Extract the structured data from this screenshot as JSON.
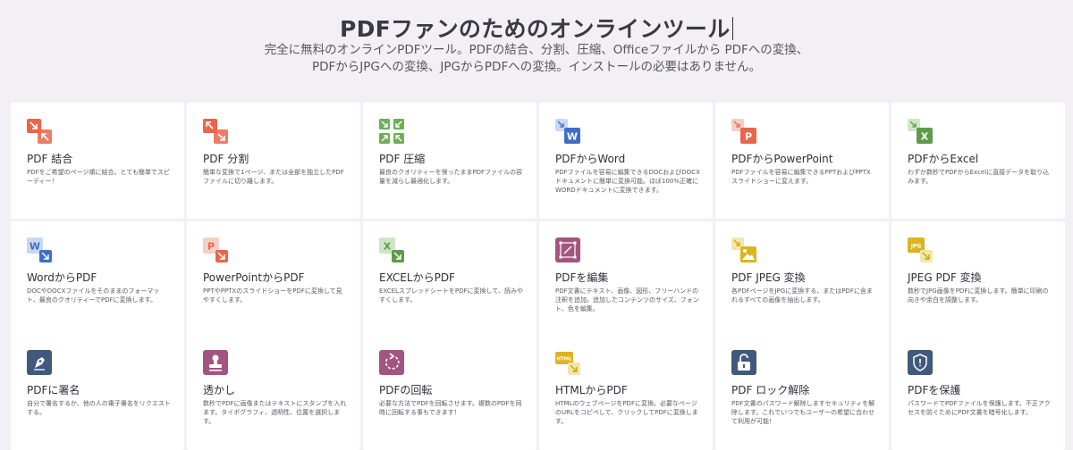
{
  "header": {
    "title": "PDFファンのためのオンラインツール",
    "subtitle_line1": "完全に無料のオンラインPDFツール。PDFの結合、分割、圧縮、Officeファイルから PDFへの変換、",
    "subtitle_line2": "PDFからJPGへの変換、JPGからPDFへの変換。インストールの必要はありません。"
  },
  "tools": [
    {
      "id": "merge",
      "icon": "merge-icon",
      "name": "PDF 結合",
      "desc": "PDFをご希望のページ順に結合。とても簡単でスピーディー！"
    },
    {
      "id": "split",
      "icon": "split-icon",
      "name": "PDF 分割",
      "desc": "簡単な変換で1ページ、または全部を独立したPDFファイルに切り離します。"
    },
    {
      "id": "compress",
      "icon": "compress-icon",
      "name": "PDF 圧縮",
      "desc": "最良のクオリティーを保ったままPDFファイルの容量を減らし最適化します。"
    },
    {
      "id": "pdf-to-word",
      "icon": "word-icon",
      "name": "PDFからWord",
      "desc": "PDFファイルを容易に編集できるDOCおよびDOCXドキュメントに簡単に変換可能。ほぼ100%正確にWORDドキュメントに変換できます。"
    },
    {
      "id": "pdf-to-powerpoint",
      "icon": "powerpoint-icon",
      "name": "PDFからPowerPoint",
      "desc": "PDFファイルを容易に編集できるPPTおよびPPTXスライドショーに変えます。"
    },
    {
      "id": "pdf-to-excel",
      "icon": "excel-icon",
      "name": "PDFからExcel",
      "desc": "わずか数秒でPDFからExcelに直接データを取り込みます。"
    },
    {
      "id": "word-to-pdf",
      "icon": "word-icon",
      "name": "WordからPDF",
      "desc": "DOCやDOCXファイルをそのままのフォーマット、最良のクオリティーでPDFに変換します。"
    },
    {
      "id": "powerpoint-to-pdf",
      "icon": "powerpoint-icon",
      "name": "PowerPointからPDF",
      "desc": "PPTやPPTXのスライドショーをPDFに変換して見やすくします。"
    },
    {
      "id": "excel-to-pdf",
      "icon": "excel-icon",
      "name": "EXCELからPDF",
      "desc": "EXCELスプレッドシートをPDFに変換して、読みやすくします。"
    },
    {
      "id": "edit-pdf",
      "icon": "edit-icon",
      "name": "PDFを編集",
      "desc": "PDF文書にテキスト、画像、図形、フリーハンドの注釈を追加。追加したコンテンツのサイズ、フォント、色を編集。"
    },
    {
      "id": "pdf-to-jpeg",
      "icon": "image-icon",
      "name": "PDF JPEG 変換",
      "desc": "各PDFページをJPGに変換する、またはPDFに含まれるすべての画像を抽出します。"
    },
    {
      "id": "jpeg-to-pdf",
      "icon": "jpg-icon",
      "name": "JPEG PDF 変換",
      "desc": "数秒でJPG画像をPDFに変換します。簡単に印刷の向きや余白を調整します。"
    },
    {
      "id": "sign-pdf",
      "icon": "pen-icon",
      "name": "PDFに署名",
      "desc": "自分で署名するか、他の人の電子署名をリクエストする。"
    },
    {
      "id": "watermark",
      "icon": "stamp-icon",
      "name": "透かし",
      "desc": "数秒でPDFに画像またはテキストにスタンプを入れます。タイポグラフィ、透明性、位置を選択します。"
    },
    {
      "id": "rotate-pdf",
      "icon": "rotate-icon",
      "name": "PDFの回転",
      "desc": "必要な方法でPDFを回転させます。複数のPDFを同時に回転する事もできます！"
    },
    {
      "id": "html-to-pdf",
      "icon": "html-icon",
      "name": "HTMLからPDF",
      "desc": "HTMLのウェブページをPDFに変換。必要なページのURLをコピペして、クリックしてPDFに変換します。"
    },
    {
      "id": "unlock-pdf",
      "icon": "unlock-icon",
      "name": "PDF ロック解除",
      "desc": "PDF文書のパスワード解除しますセキュリティを解除します。これでいつでもユーザーの希望に合わせて利用が可能！"
    },
    {
      "id": "protect-pdf",
      "icon": "shield-icon",
      "name": "PDFを保護",
      "desc": "パスワードでPDFファイルを保護します。不正アクセスを防ぐためにPDF文書を暗号化します。"
    }
  ],
  "icon_labels": {
    "word": "W",
    "powerpoint": "P",
    "excel": "X",
    "jpg": "JPG",
    "html": "HTML"
  },
  "colors": {
    "orange": "#e8664a",
    "green": "#6fae5a",
    "blue": "#3f6fc4",
    "purple": "#a2557f",
    "yellow": "#dcb41c",
    "navy": "#40597c"
  }
}
